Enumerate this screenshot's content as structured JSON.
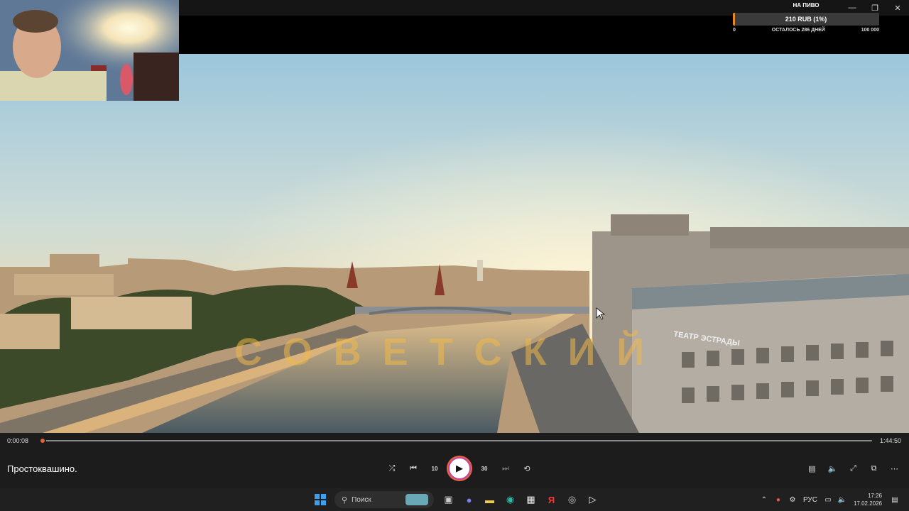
{
  "window": {
    "minimize_icon": "minimize-icon",
    "restore_icon": "restore-icon",
    "close_icon": "close-icon"
  },
  "donation": {
    "title": "НА ПИВО",
    "amount": "210 RUB (1%)",
    "progress_fraction": 0.01,
    "min": "0",
    "remaining": "ОСТАЛОСЬ 286 ДНЕЙ",
    "max": "100 000",
    "fill_color": "#e88a1a"
  },
  "video": {
    "overlay_text": "СОВЕТСКИЙ",
    "sign_text": "ТЕАТР ЭСТРАДЫ"
  },
  "player": {
    "current_time": "0:00:08",
    "total_time": "1:44:50",
    "progress_fraction": 0.0013,
    "title": "Простоквашино.",
    "accent_color": "#e0643a",
    "controls": {
      "shuffle_icon": "shuffle-icon",
      "previous_icon": "previous-icon",
      "rewind_label": "10",
      "play_icon": "play-icon",
      "forward_label": "30",
      "next_icon": "next-icon",
      "repeat_icon": "repeat-off-icon"
    },
    "right_controls": [
      "captions-icon",
      "volume-icon",
      "fullscreen-icon",
      "mini-player-icon",
      "more-icon"
    ]
  },
  "taskbar": {
    "search_placeholder": "Поиск",
    "language": "РУС",
    "time": "17:26",
    "date": "17.02.2026",
    "apps": [
      "start-icon",
      "search-icon",
      "task-view-icon",
      "teams-icon",
      "file-explorer-icon",
      "edge-icon",
      "store-icon",
      "yandex-icon",
      "chrome-icon",
      "media-player-icon"
    ]
  }
}
